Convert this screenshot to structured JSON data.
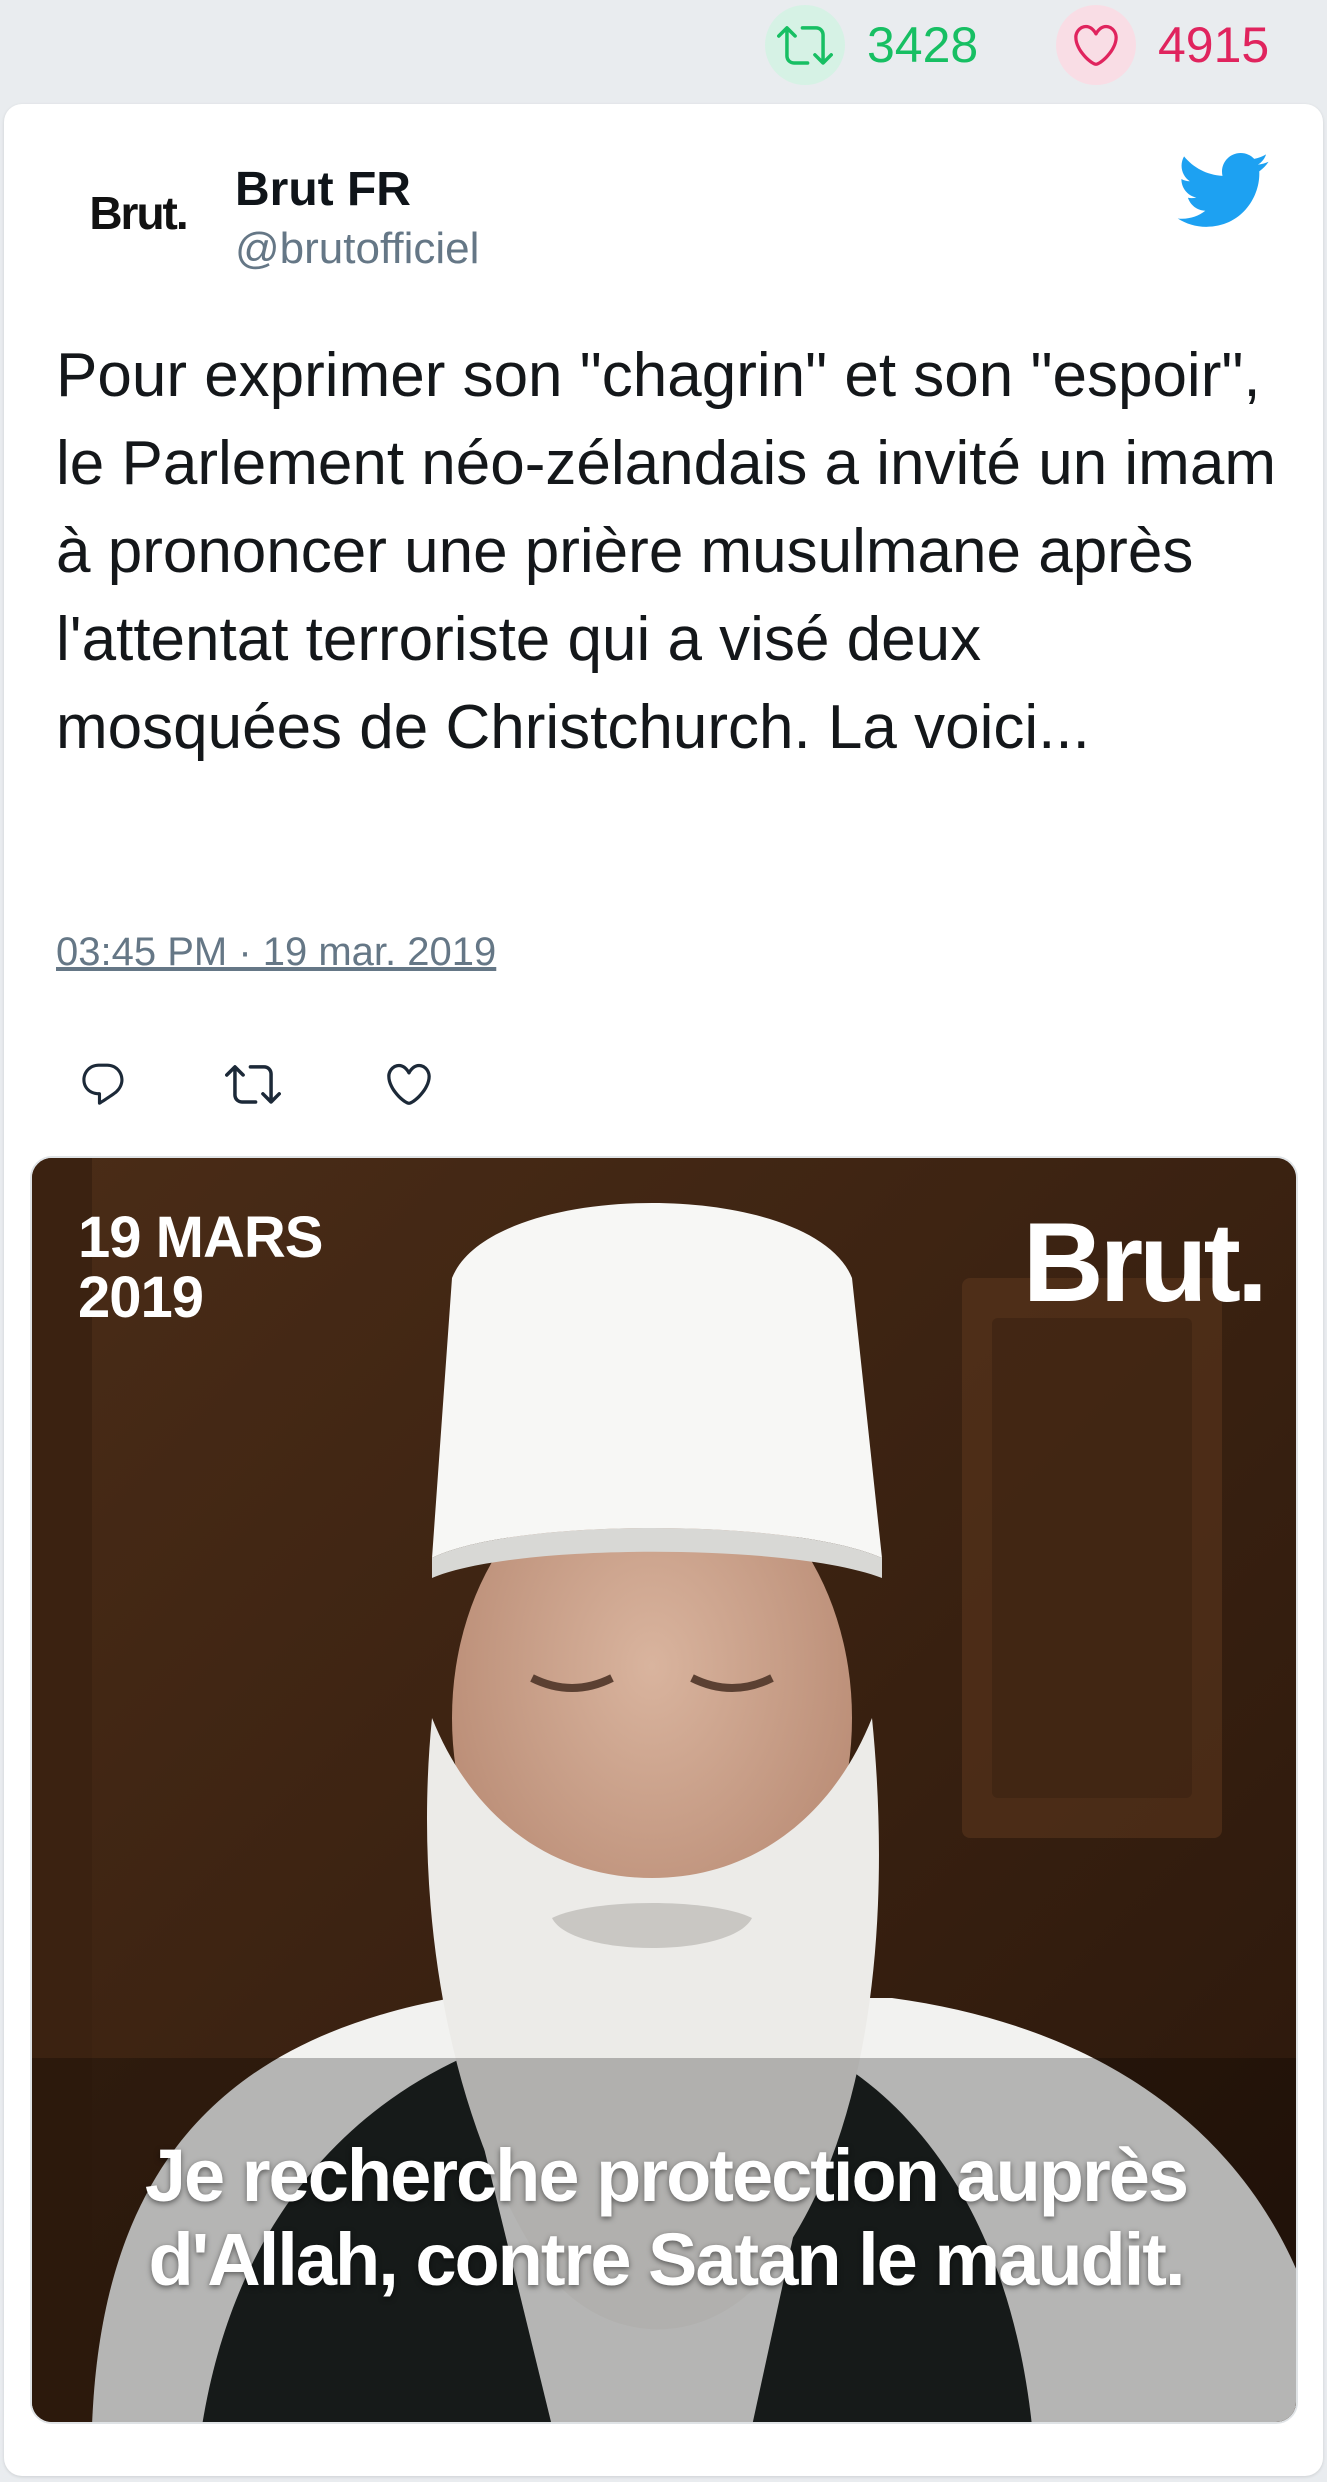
{
  "stats": {
    "retweets": "3428",
    "likes": "4915",
    "retweet_color": "#17bf63",
    "like_color": "#e0245e",
    "retweet_icon": "retweet-icon",
    "like_icon": "heart-icon"
  },
  "author": {
    "avatar_text": "Brut.",
    "name": "Brut FR",
    "handle": "@brutofficiel"
  },
  "tweet": {
    "text": "Pour exprimer son \"chagrin\" et son \"espoir\", le Parlement néo-zélandais a invité un imam à prononcer une prière musulmane après l'attentat terroriste qui a visé deux mosquées de Christchurch. La voici...",
    "timestamp": "03:45 PM · 19 mar. 2019"
  },
  "actions": [
    "reply-icon",
    "retweet-icon",
    "heart-icon"
  ],
  "media": {
    "date_line1": "19 MARS",
    "date_line2": "2019",
    "logo": "Brut.",
    "caption_line1": "Je recherche protection auprès",
    "caption_line2": "d'Allah, contre Satan le maudit."
  },
  "colors": {
    "twitter_blue": "#1da1f2",
    "text": "#14171a",
    "secondary": "#657786",
    "background": "#e9ecef"
  }
}
